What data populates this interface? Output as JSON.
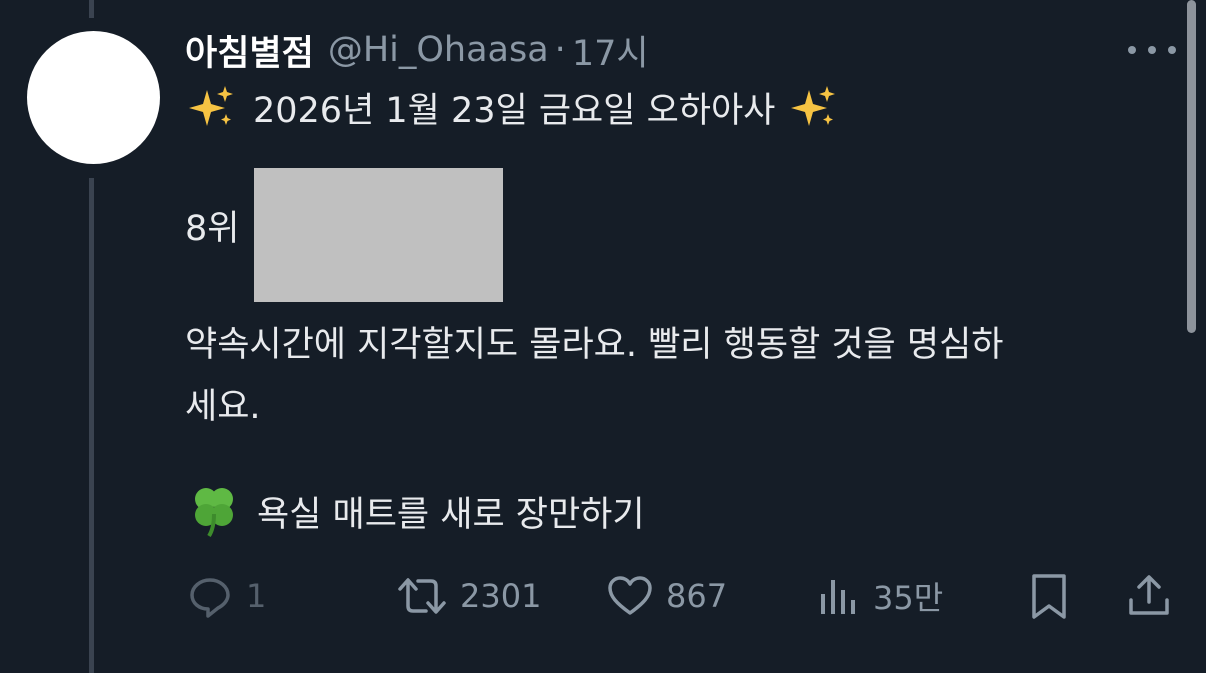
{
  "post": {
    "display_name": "아침별점",
    "handle": "@Hi_Ohaasa",
    "separator": "·",
    "time": "17시",
    "title_line": "2026년 1월 23일 금요일 오하아사",
    "rank": "8위",
    "fortune_line1": "약속시간에 지각할지도 몰라요. 빨리 행동할 것을 명심하",
    "fortune_line2": "세요.",
    "lucky_item": "욕실 매트를 새로 장만하기"
  },
  "actions": {
    "reply_count": "1",
    "retweet_count": "2301",
    "like_count": "867",
    "view_count": "35만"
  },
  "icons": {
    "more": "more-horizontal-icon",
    "sparkle": "sparkles-emoji-icon",
    "clover": "four-leaf-clover-emoji-icon",
    "reply": "reply-icon",
    "retweet": "retweet-icon",
    "like": "heart-icon",
    "views": "views-icon",
    "bookmark": "bookmark-icon",
    "share": "share-icon"
  },
  "colors": {
    "background": "#151d27",
    "primary_text": "#e8eaed",
    "secondary_text": "#8b98a5",
    "redaction": "#c0c0c0"
  }
}
